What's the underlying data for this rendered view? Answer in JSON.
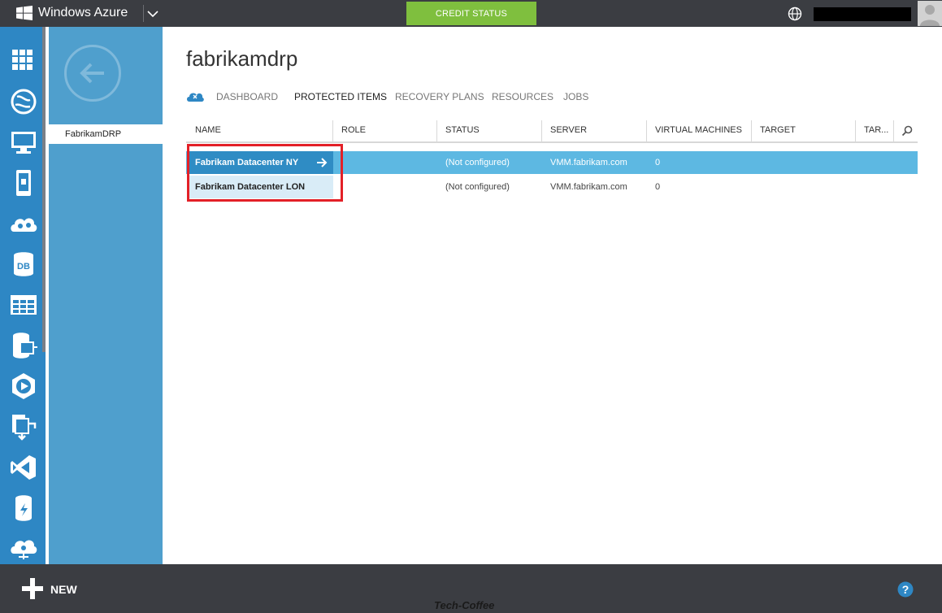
{
  "topbar": {
    "brand": "Windows Azure",
    "credit_button": "CREDIT STATUS"
  },
  "subnav": {
    "selected_item": "FabrikamDRP"
  },
  "page": {
    "title": "fabrikamdrp",
    "tabs": [
      "DASHBOARD",
      "PROTECTED ITEMS",
      "RECOVERY PLANS",
      "RESOURCES",
      "JOBS"
    ],
    "active_tab": "PROTECTED ITEMS"
  },
  "table": {
    "columns": [
      "NAME",
      "ROLE",
      "STATUS",
      "SERVER",
      "VIRTUAL MACHINES",
      "TARGET",
      "TAR..."
    ],
    "rows": [
      {
        "name": "Fabrikam Datacenter NY",
        "role": "",
        "status": "(Not configured)",
        "server": "VMM.fabrikam.com",
        "vms": "0",
        "target": "",
        "tar": "",
        "selected": true
      },
      {
        "name": "Fabrikam Datacenter LON",
        "role": "",
        "status": "(Not configured)",
        "server": "VMM.fabrikam.com",
        "vms": "0",
        "target": "",
        "tar": "",
        "selected": false
      }
    ]
  },
  "bottombar": {
    "new_label": "NEW",
    "watermark": "Tech-Coffee"
  },
  "colors": {
    "topbar": "#3b3d42",
    "rail": "#2e87c4",
    "subnav": "#4f9fcd",
    "credit": "#7fbf3e",
    "row_selected": "#5db8e2",
    "highlight": "#e32027"
  },
  "icons": [
    "windows-logo-icon",
    "chevron-down-icon",
    "globe-icon",
    "avatar-icon",
    "all-items-icon",
    "web-sites-icon",
    "virtual-machines-icon",
    "mobile-services-icon",
    "cloud-services-icon",
    "sql-databases-icon",
    "storage-icon",
    "hdinsight-icon",
    "media-services-icon",
    "recovery-services-icon",
    "visual-studio-icon",
    "cache-icon",
    "service-bus-icon",
    "back-arrow-icon",
    "recovery-cloud-icon",
    "search-icon",
    "arrow-right-icon",
    "plus-icon",
    "help-icon"
  ]
}
